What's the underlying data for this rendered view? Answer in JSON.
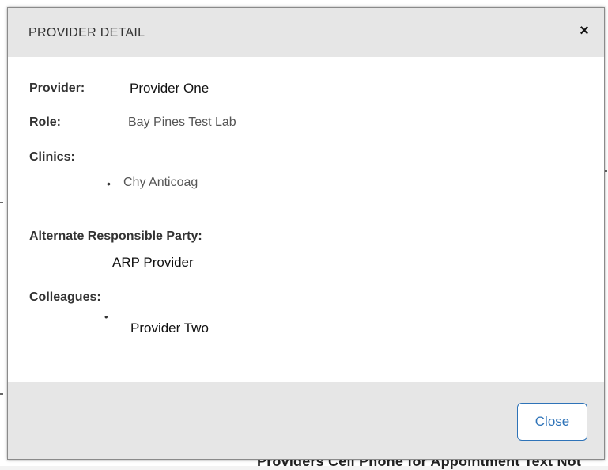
{
  "background": {
    "partial_text": "Providers Cell Phone for Appointment Text Not"
  },
  "modal": {
    "title": "PROVIDER DETAIL",
    "close_icon": "×",
    "provider_label": "Provider:",
    "provider_value": "Provider One",
    "role_label": "Role:",
    "role_value": "Bay Pines Test Lab",
    "clinics_label": "Clinics:",
    "clinics": [
      "Chy Anticoag"
    ],
    "arp_label": "Alternate Responsible Party:",
    "arp_value": "ARP Provider",
    "colleagues_label": "Colleagues:",
    "colleagues": [
      "Provider Two"
    ],
    "close_button_label": "Close"
  },
  "colors": {
    "header_bg": "#e6e6e6",
    "footer_bg": "#e6e6e6",
    "button_accent": "#2e73b8"
  }
}
